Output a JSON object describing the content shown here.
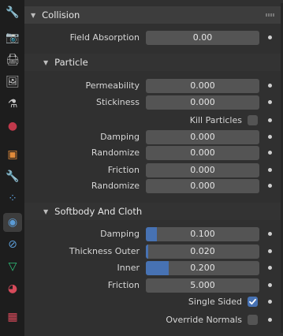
{
  "sidebar_tabs": [
    {
      "icon": "tool-icon",
      "glyph": "🔧",
      "color": "#b8b8b8"
    },
    {
      "icon": "render-icon",
      "glyph": "📷",
      "color": "#c8c8c8"
    },
    {
      "icon": "output-icon",
      "glyph": "🖨",
      "color": "#c8c8c8"
    },
    {
      "icon": "view-layer-icon",
      "glyph": "🖼",
      "color": "#c8c8c8"
    },
    {
      "icon": "scene-icon",
      "glyph": "⚗",
      "color": "#c8c8c8"
    },
    {
      "icon": "world-icon",
      "glyph": "●",
      "color": "#c0394b"
    },
    {
      "icon": "object-icon",
      "glyph": "▣",
      "color": "#e08a3a"
    },
    {
      "icon": "modifier-icon",
      "glyph": "🔧",
      "color": "#5b9bd5"
    },
    {
      "icon": "particles-icon",
      "glyph": "⁘",
      "color": "#5b9bd5"
    },
    {
      "icon": "physics-icon",
      "glyph": "◉",
      "color": "#5b9bd5"
    },
    {
      "icon": "constraints-icon",
      "glyph": "⊘",
      "color": "#5b9bd5"
    },
    {
      "icon": "data-icon",
      "glyph": "▽",
      "color": "#2fc17a"
    },
    {
      "icon": "material-icon",
      "glyph": "◕",
      "color": "#d64a5a"
    },
    {
      "icon": "texture-icon",
      "glyph": "▦",
      "color": "#d64a5a"
    }
  ],
  "collision": {
    "title": "Collision",
    "field_absorption": {
      "label": "Field Absorption",
      "value": "0.00"
    }
  },
  "particle": {
    "title": "Particle",
    "permeability": {
      "label": "Permeability",
      "value": "0.000"
    },
    "stickiness": {
      "label": "Stickiness",
      "value": "0.000"
    },
    "kill_particles": {
      "label": "Kill Particles",
      "checked": false
    },
    "damping": {
      "label": "Damping",
      "value": "0.000"
    },
    "damping_randomize": {
      "label": "Randomize",
      "value": "0.000"
    },
    "friction": {
      "label": "Friction",
      "value": "0.000"
    },
    "friction_randomize": {
      "label": "Randomize",
      "value": "0.000"
    }
  },
  "softbody_cloth": {
    "title": "Softbody And Cloth",
    "damping": {
      "label": "Damping",
      "value": "0.100",
      "fill_fraction": 0.1
    },
    "thickness_outer": {
      "label": "Thickness Outer",
      "value": "0.020",
      "fill_fraction": 0.02
    },
    "inner": {
      "label": "Inner",
      "value": "0.200",
      "fill_fraction": 0.2
    },
    "friction": {
      "label": "Friction",
      "value": "5.000",
      "fill_fraction": 0.0
    },
    "single_sided": {
      "label": "Single Sided",
      "checked": true
    },
    "override_normals": {
      "label": "Override Normals",
      "checked": false
    }
  },
  "colors": {
    "accent": "#4772b3",
    "field": "#545454",
    "panel": "#303030"
  }
}
